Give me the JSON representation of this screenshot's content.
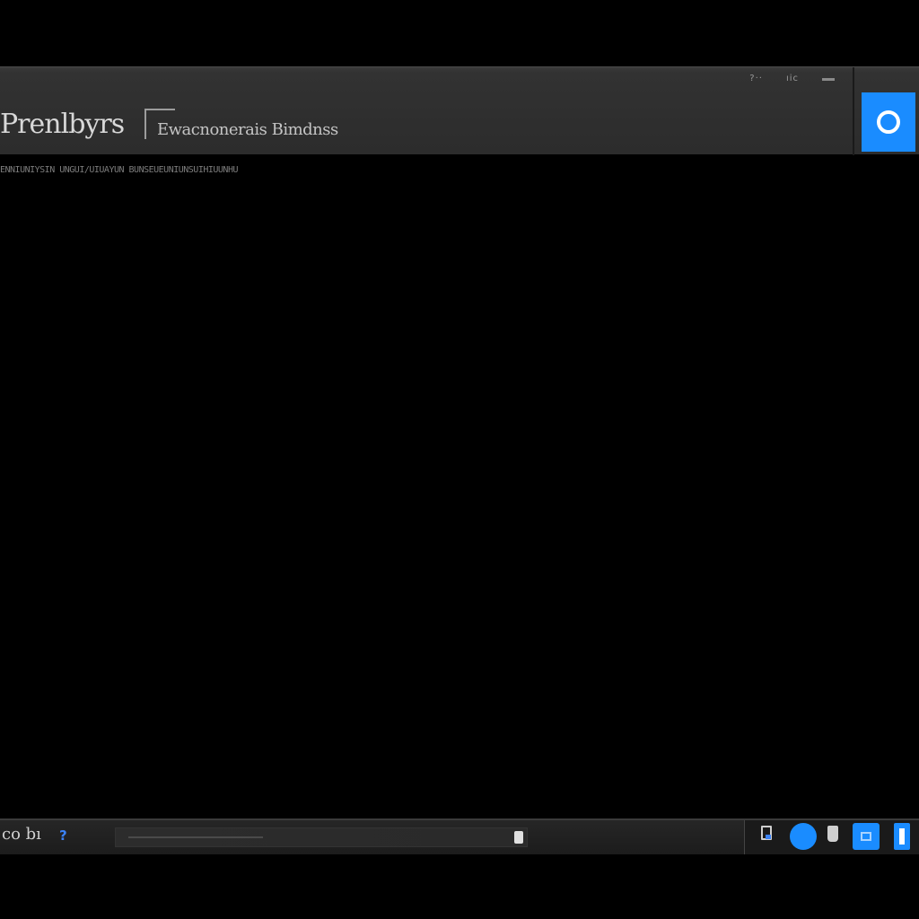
{
  "window": {
    "app_name": "Prenlbyrs",
    "subtitle": "Ewacnonerais Bimdnss",
    "controls": {
      "help_label": "?··",
      "restore_label": "ıic"
    }
  },
  "breadcrumb": {
    "text": "ENNIUNIYSIN UNGUI/UIUAYUN BUNSEUEUNIUNSUIHIUUNHU"
  },
  "taskbar": {
    "start_label": "co bı",
    "help_label": "?"
  },
  "colors": {
    "background": "#000000",
    "accent": "#1a8cff",
    "bar": "#2c2c2c"
  },
  "icons": {
    "tile": "refresh-ring-icon",
    "tray": [
      "document-icon",
      "circle-app-icon",
      "cup-icon",
      "window-square-icon",
      "bar-app-icon"
    ]
  }
}
